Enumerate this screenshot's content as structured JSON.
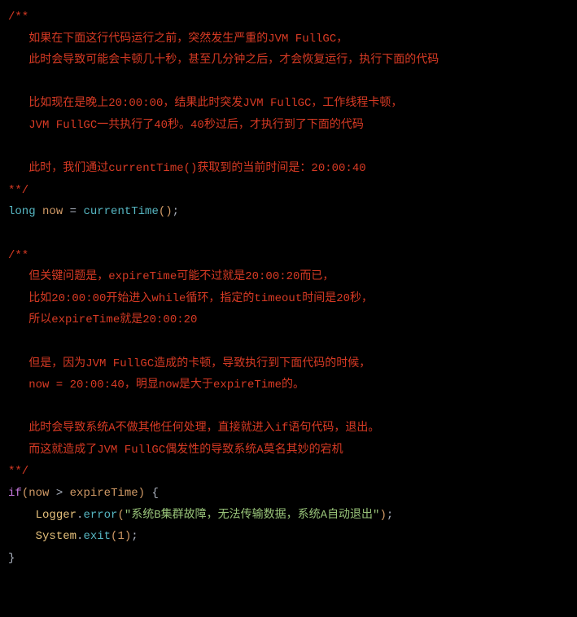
{
  "comment1": {
    "open": "/**",
    "l1": "   如果在下面这行代码运行之前，突然发生严重的JVM FullGC，",
    "l2": "   此时会导致可能会卡顿几十秒，甚至几分钟之后，才会恢复运行，执行下面的代码",
    "l3": "",
    "l4": "   比如现在是晚上20:00:00，结果此时突发JVM FullGC，工作线程卡顿，",
    "l5": "   JVM FullGC一共执行了40秒。40秒过后，才执行到了下面的代码",
    "l6": "",
    "l7": "   此时，我们通过currentTime()获取到的当前时间是：20:00:40",
    "close": "**/"
  },
  "line1": {
    "type": "long",
    "var": " now ",
    "eq": "= ",
    "func": "currentTime",
    "open": "(",
    "close": ")",
    "semi": ";"
  },
  "comment2": {
    "open": "/**",
    "l1": "   但关键问题是，expireTime可能不过就是20:00:20而已，",
    "l2": "   比如20:00:00开始进入while循环，指定的timeout时间是20秒，",
    "l3": "   所以expireTime就是20:00:20",
    "l4": "",
    "l5": "   但是，因为JVM FullGC造成的卡顿，导致执行到下面代码的时候，",
    "l6": "   now = 20:00:40，明显now是大于expireTime的。",
    "l7": "",
    "l8": "   此时会导致系统A不做其他任何处理，直接就进入if语句代码，退出。",
    "l9": "   而这就造成了JVM FullGC偶发性的导致系统A莫名其妙的宕机",
    "close": "**/"
  },
  "ifline": {
    "kw": "if",
    "open": "(",
    "var1": "now",
    "op": " > ",
    "var2": "expireTime",
    "close": ")",
    "space": " ",
    "brace": "{"
  },
  "logger": {
    "indent": "    ",
    "obj": "Logger",
    "dot": ".",
    "method": "error",
    "open": "(",
    "str": "\"系统B集群故障，无法传输数据，系统A自动退出\"",
    "close": ")",
    "semi": ";"
  },
  "exit": {
    "indent": "    ",
    "obj": "System",
    "dot": ".",
    "method": "exit",
    "open": "(",
    "num": "1",
    "close": ")",
    "semi": ";"
  },
  "endbrace": "}"
}
